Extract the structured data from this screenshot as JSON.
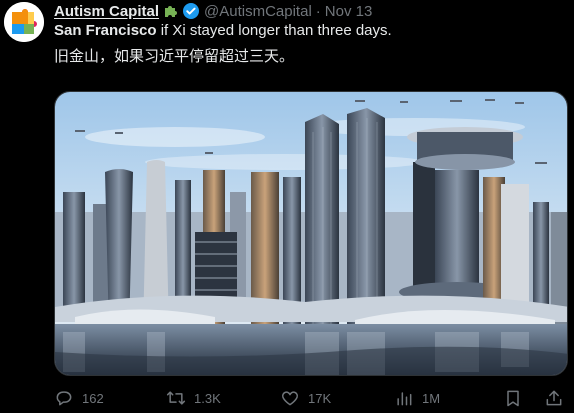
{
  "tweet": {
    "author_name": "Autism Capital",
    "emoji_icon": "puzzle-piece-icon",
    "verified_icon": "verified-badge-icon",
    "handle": "@AutismCapital",
    "separator": "·",
    "timestamp": "Nov 13",
    "line1_bold": "San Francisco",
    "line1_rest": " if Xi stayed longer than three days.",
    "line2": "旧金山，如果习近平停留超过三天。"
  },
  "colors": {
    "background": "#000000",
    "text": "#e7e9ea",
    "muted": "#71767b",
    "verified": "#1d9bf0",
    "emoji_green": "#77b255"
  },
  "actions": {
    "reply_icon": "reply-icon",
    "reply_count": "162",
    "retweet_icon": "retweet-icon",
    "retweet_count": "1.3K",
    "like_icon": "heart-icon",
    "like_count": "17K",
    "views_icon": "views-chart-icon",
    "views_count": "1M",
    "bookmark_icon": "bookmark-icon",
    "share_icon": "share-icon"
  }
}
